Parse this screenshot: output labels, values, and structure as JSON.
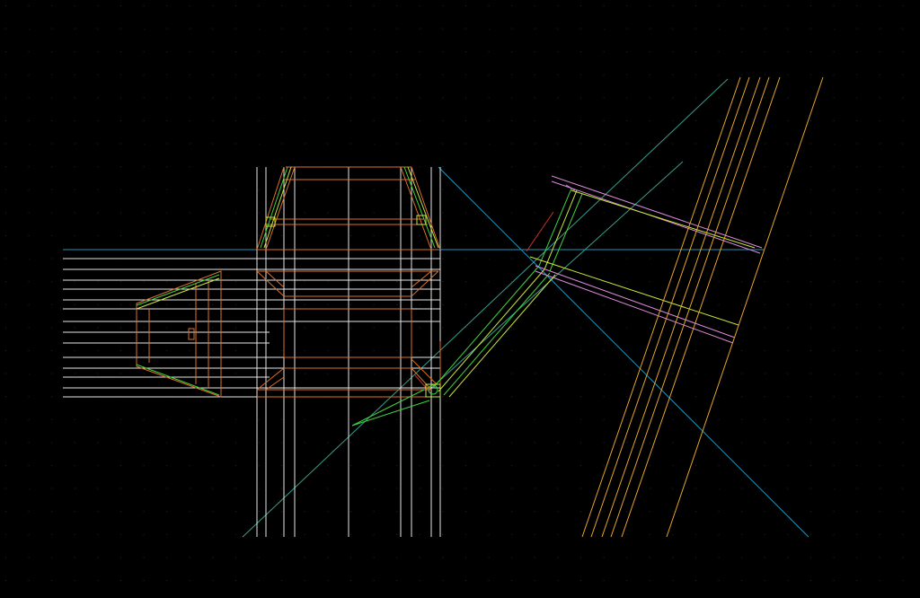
{
  "drawing": {
    "background_color": "#000000",
    "grid_dot_color": "#2b2b2b",
    "colors": {
      "white": "#e6e6e6",
      "orange": "#d9702c",
      "yellow_orange": "#e6a52a",
      "green": "#3fd33f",
      "yellow_green": "#c8e63c",
      "cyan": "#2a8fb5",
      "teal": "#3a9c8c",
      "pink": "#d98ad9",
      "red": "#c8302a"
    }
  }
}
